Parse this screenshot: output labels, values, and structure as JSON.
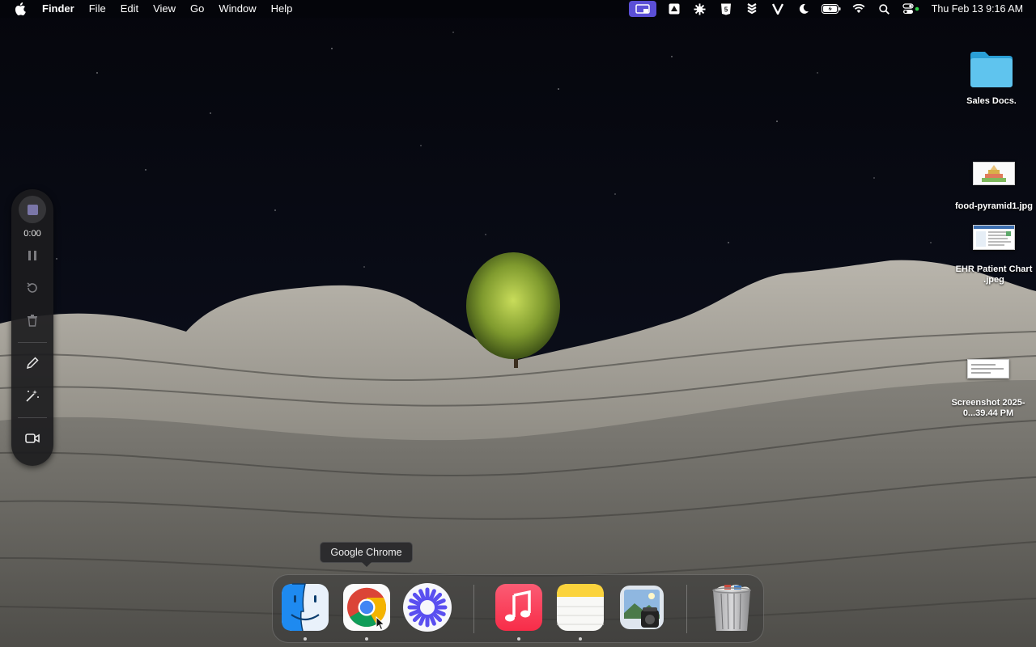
{
  "menubar": {
    "app_name": "Finder",
    "menus": [
      "File",
      "Edit",
      "View",
      "Go",
      "Window",
      "Help"
    ],
    "status_icons": [
      "screen-share-icon",
      "drive-icon",
      "gear-icon",
      "html5-icon",
      "dropbox-icon",
      "vectorworks-icon",
      "moon-icon",
      "battery-icon",
      "wifi-icon",
      "search-icon",
      "control-center-icon"
    ],
    "clock": "Thu Feb 13  9:16 AM"
  },
  "desktop_icons": [
    {
      "label": "Sales Docs.",
      "type": "folder"
    },
    {
      "label": "food-pyramid1.jpg",
      "type": "image"
    },
    {
      "label": "EHR Patient Chart .jpeg",
      "type": "image"
    },
    {
      "label": "Screenshot 2025-0...39.44 PM",
      "type": "image"
    }
  ],
  "recording_toolbar": {
    "timer": "0:00",
    "buttons": [
      "stop-icon",
      "pause-icon",
      "restart-icon",
      "trash-icon",
      "pen-icon",
      "magic-wand-icon",
      "camera-icon"
    ]
  },
  "tooltip": {
    "text": "Google Chrome"
  },
  "dock": {
    "apps": [
      {
        "name": "Finder",
        "running": true
      },
      {
        "name": "Google Chrome",
        "running": true
      },
      {
        "name": "Perplexity",
        "running": false
      },
      {
        "name": "Music",
        "running": true
      },
      {
        "name": "Notes",
        "running": true
      },
      {
        "name": "Preview",
        "running": false
      },
      {
        "name": "Trash",
        "running": false
      }
    ]
  },
  "colors": {
    "accent": "#5b4fd6",
    "menubar_text": "#ffffff",
    "dock_bg": "#323232"
  }
}
